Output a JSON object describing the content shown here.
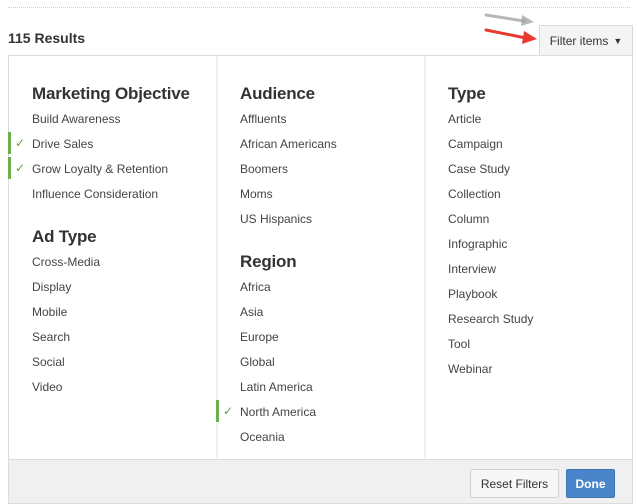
{
  "results": {
    "count_label": "115 Results"
  },
  "filter_button": {
    "label": "Filter items",
    "caret": "▼"
  },
  "columns": {
    "marketing_objective": {
      "title": "Marketing Objective",
      "items": [
        {
          "label": "Build Awareness",
          "checked": false
        },
        {
          "label": "Drive Sales",
          "checked": true
        },
        {
          "label": "Grow Loyalty & Retention",
          "checked": true
        },
        {
          "label": "Influence Consideration",
          "checked": false
        }
      ]
    },
    "ad_type": {
      "title": "Ad Type",
      "items": [
        {
          "label": "Cross-Media",
          "checked": false
        },
        {
          "label": "Display",
          "checked": false
        },
        {
          "label": "Mobile",
          "checked": false
        },
        {
          "label": "Search",
          "checked": false
        },
        {
          "label": "Social",
          "checked": false
        },
        {
          "label": "Video",
          "checked": false
        }
      ]
    },
    "audience": {
      "title": "Audience",
      "items": [
        {
          "label": "Affluents",
          "checked": false
        },
        {
          "label": "African Americans",
          "checked": false
        },
        {
          "label": "Boomers",
          "checked": false
        },
        {
          "label": "Moms",
          "checked": false
        },
        {
          "label": "US Hispanics",
          "checked": false
        }
      ]
    },
    "region": {
      "title": "Region",
      "items": [
        {
          "label": "Africa",
          "checked": false
        },
        {
          "label": "Asia",
          "checked": false
        },
        {
          "label": "Europe",
          "checked": false
        },
        {
          "label": "Global",
          "checked": false
        },
        {
          "label": "Latin America",
          "checked": false
        },
        {
          "label": "North America",
          "checked": true
        },
        {
          "label": "Oceania",
          "checked": false
        }
      ]
    },
    "type": {
      "title": "Type",
      "items": [
        {
          "label": "Article",
          "checked": false
        },
        {
          "label": "Campaign",
          "checked": false
        },
        {
          "label": "Case Study",
          "checked": false
        },
        {
          "label": "Collection",
          "checked": false
        },
        {
          "label": "Column",
          "checked": false
        },
        {
          "label": "Infographic",
          "checked": false
        },
        {
          "label": "Interview",
          "checked": false
        },
        {
          "label": "Playbook",
          "checked": false
        },
        {
          "label": "Research Study",
          "checked": false
        },
        {
          "label": "Tool",
          "checked": false
        },
        {
          "label": "Webinar",
          "checked": false
        }
      ]
    }
  },
  "footer": {
    "reset_label": "Reset Filters",
    "done_label": "Done"
  },
  "icons": {
    "check": "check-icon",
    "caret": "caret-down-icon",
    "arrow": "arrow-icon"
  },
  "colors": {
    "accent_green": "#6ab04c",
    "done_blue": "#4a85c9",
    "arrow_red": "#e8392f"
  }
}
